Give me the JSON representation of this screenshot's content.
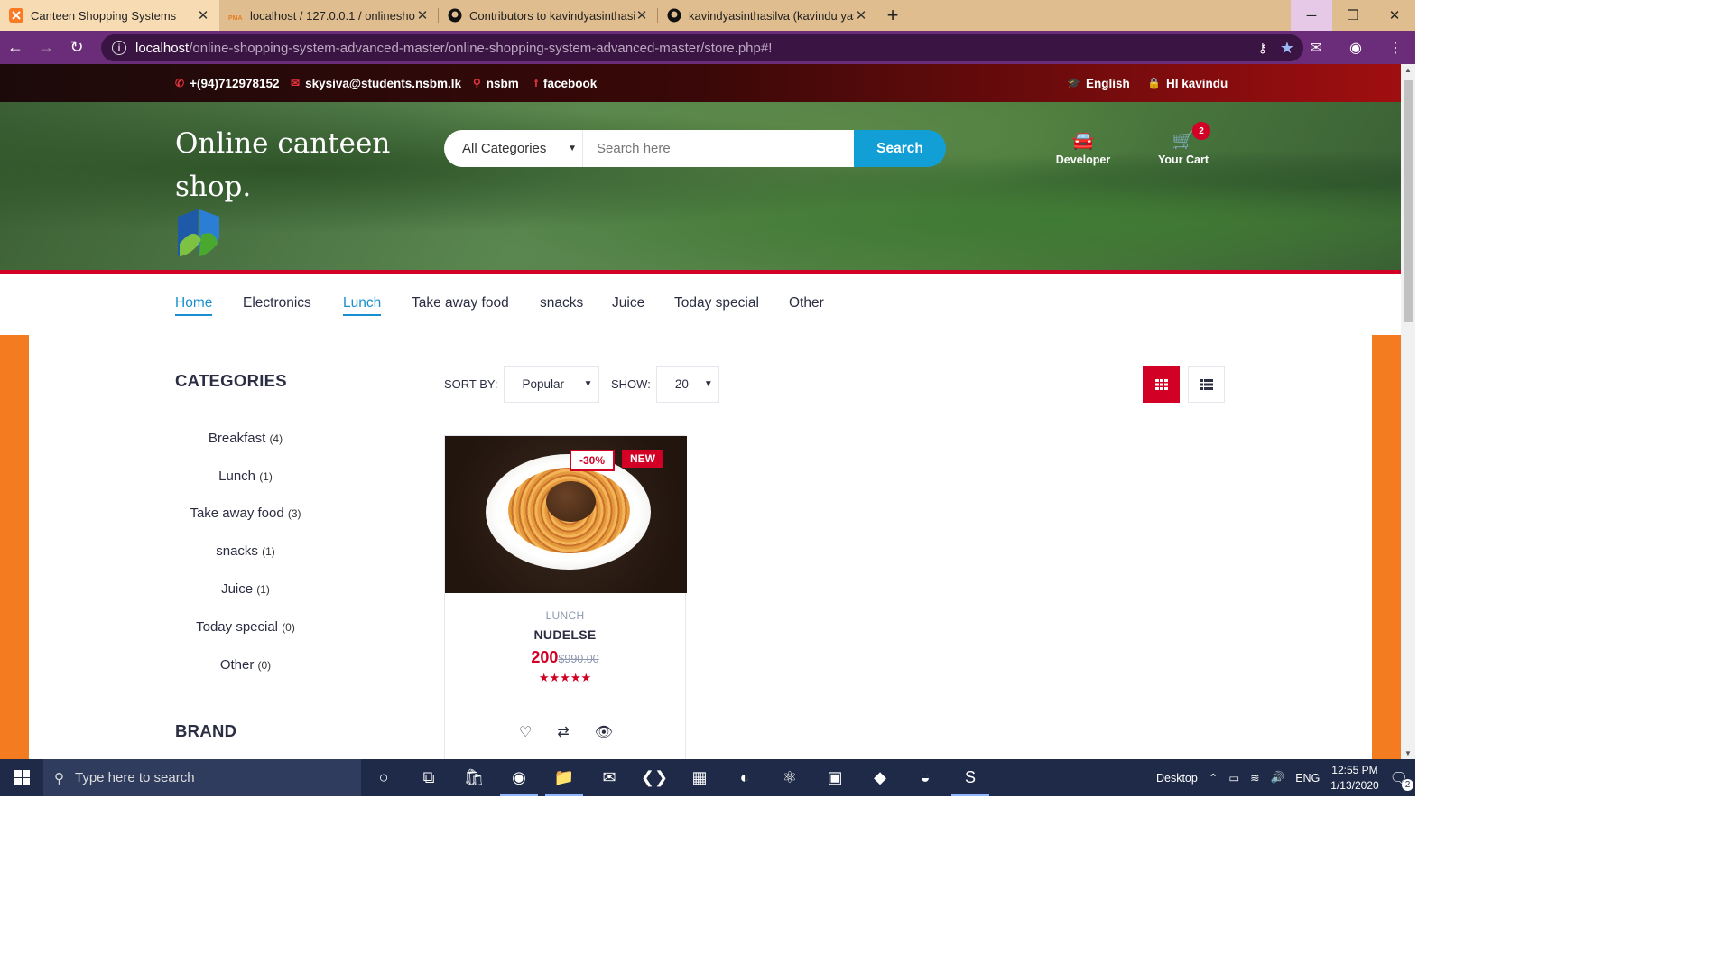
{
  "browser": {
    "tabs": [
      {
        "title": "Canteen Shopping Systems",
        "active": true
      },
      {
        "title": "localhost / 127.0.0.1 / onlineshop",
        "active": false
      },
      {
        "title": "Contributors to kavindyasinthasil",
        "active": false
      },
      {
        "title": "kavindyasinthasilva (kavindu yasi",
        "active": false
      }
    ],
    "url_host": "localhost",
    "url_path": "/online-shopping-system-advanced-master/online-shopping-system-advanced-master/store.php#!"
  },
  "topbar": {
    "phone": "+(94)712978152",
    "email": "skysiva@students.nsbm.lk",
    "location": "nsbm",
    "social": "facebook",
    "language": "English",
    "user": "HI kavindu"
  },
  "header": {
    "shop_title": "Online canteen shop.",
    "category_select": "All Categories",
    "search_placeholder": "Search here",
    "search_button": "Search",
    "developer_label": "Developer",
    "cart_label": "Your Cart",
    "cart_count": "2"
  },
  "nav": {
    "items": [
      "Home",
      "Electronics",
      "Lunch",
      "Take away food",
      "snacks",
      "Juice",
      "Today special",
      "Other"
    ]
  },
  "sidebar": {
    "categories_heading": "CATEGORIES",
    "categories": [
      {
        "name": "Breakfast",
        "count": "(4)"
      },
      {
        "name": "Lunch",
        "count": "(1)"
      },
      {
        "name": "Take away food",
        "count": "(3)"
      },
      {
        "name": "snacks",
        "count": "(1)"
      },
      {
        "name": "Juice",
        "count": "(1)"
      },
      {
        "name": "Today special",
        "count": "(0)"
      },
      {
        "name": "Other",
        "count": "(0)"
      }
    ],
    "brand_heading": "BRAND"
  },
  "toolbar": {
    "sort_label": "SORT BY:",
    "sort_value": "Popular",
    "show_label": "SHOW:",
    "show_value": "20"
  },
  "product": {
    "sale_tag": "-30%",
    "new_tag": "NEW",
    "category": "LUNCH",
    "name": "NUDELSE",
    "price": "200",
    "old_price": "$990.00",
    "rating": 5
  },
  "taskbar": {
    "search_placeholder": "Type here to search",
    "desktop_label": "Desktop",
    "language": "ENG",
    "time": "12:55 PM",
    "date": "1/13/2020",
    "notifications": "2"
  }
}
